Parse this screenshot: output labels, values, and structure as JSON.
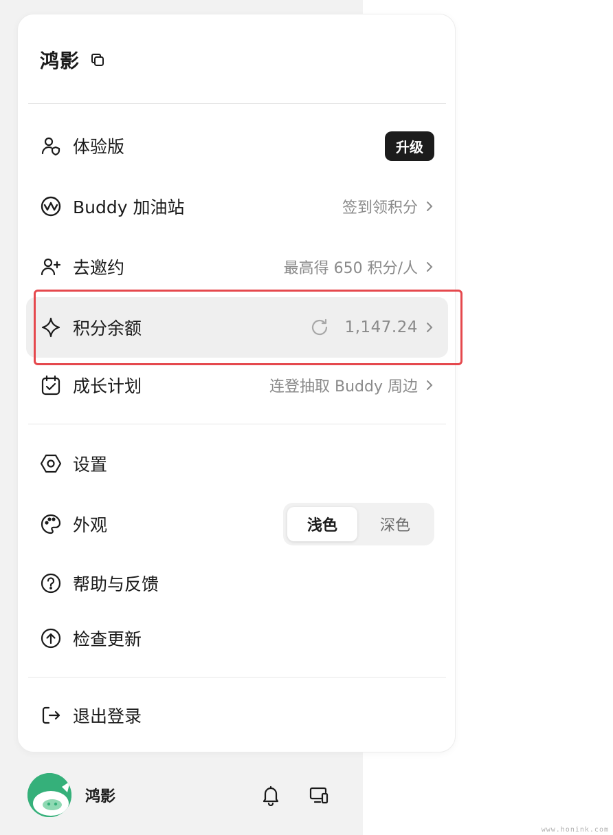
{
  "header": {
    "title": "鸿影",
    "copy_icon": "copy-icon"
  },
  "menu": {
    "plan": {
      "label": "体验版",
      "badge": "升级",
      "icon": "user-shield-icon"
    },
    "station": {
      "label": "Buddy 加油站",
      "right": "签到领积分",
      "icon": "wave-circle-icon"
    },
    "invite": {
      "label": "去邀约",
      "right": "最高得 650 积分/人",
      "icon": "user-plus-icon"
    },
    "points": {
      "label": "积分余额",
      "value": "1,147.24",
      "icon": "sparkle-icon"
    },
    "growth": {
      "label": "成长计划",
      "right": "连登抽取 Buddy 周边",
      "icon": "calendar-check-icon"
    },
    "settings": {
      "label": "设置",
      "icon": "hexagon-settings-icon"
    },
    "appearance": {
      "label": "外观",
      "light": "浅色",
      "dark": "深色",
      "selected": "浅色",
      "icon": "palette-icon"
    },
    "help": {
      "label": "帮助与反馈",
      "icon": "question-circle-icon"
    },
    "update": {
      "label": "检查更新",
      "icon": "arrow-up-circle-icon"
    },
    "logout": {
      "label": "退出登录",
      "icon": "logout-icon"
    }
  },
  "footer": {
    "name": "鸿影",
    "bell": "bell-icon",
    "device": "devices-icon"
  },
  "watermark": "www.honink.com",
  "colors": {
    "highlight": "#e5484d",
    "badge_bg": "#1c1c1c",
    "avatar": "#35b07a"
  }
}
